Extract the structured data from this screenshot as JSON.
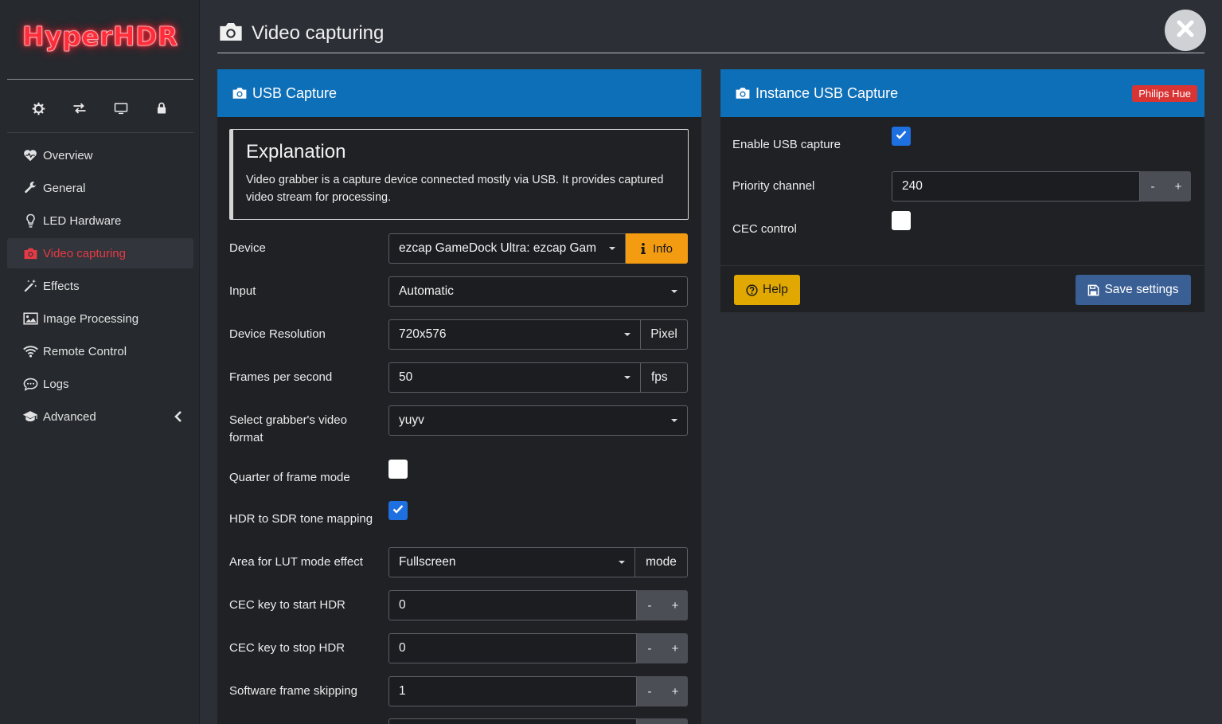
{
  "app": {
    "logo_text": "HyperHDR"
  },
  "sidebar": {
    "top_icons": [
      "gear-icon",
      "exchange-icon",
      "monitor-icon",
      "lock-icon"
    ],
    "items": [
      {
        "label": "Overview",
        "icon": "heartbeat-icon"
      },
      {
        "label": "General",
        "icon": "wrench-icon"
      },
      {
        "label": "LED Hardware",
        "icon": "lightbulb-icon"
      },
      {
        "label": "Video capturing",
        "icon": "camera-icon",
        "active": true
      },
      {
        "label": "Effects",
        "icon": "magic-wand-icon"
      },
      {
        "label": "Image Processing",
        "icon": "image-icon"
      },
      {
        "label": "Remote Control",
        "icon": "wifi-icon"
      },
      {
        "label": "Logs",
        "icon": "chat-icon"
      },
      {
        "label": "Advanced",
        "icon": "graduation-cap-icon"
      }
    ]
  },
  "header": {
    "title": "Video capturing"
  },
  "usb_panel": {
    "title": "USB Capture",
    "explanation": {
      "heading": "Explanation",
      "text": "Video grabber is a capture device connected mostly via USB. It provides captured video stream for processing."
    },
    "device": {
      "label": "Device",
      "value": "ezcap GameDock Ultra: ezcap Gam",
      "button": "Info"
    },
    "input": {
      "label": "Input",
      "value": "Automatic"
    },
    "resolution": {
      "label": "Device Resolution",
      "value": "720x576",
      "unit": "Pixel"
    },
    "fps": {
      "label": "Frames per second",
      "value": "50",
      "unit": "fps"
    },
    "format": {
      "label": "Select grabber's video format",
      "value": "yuyv"
    },
    "quarter": {
      "label": "Quarter of frame mode",
      "checked": false
    },
    "hdr": {
      "label": "HDR to SDR tone mapping",
      "checked": true
    },
    "lut": {
      "label": "Area for LUT mode effect",
      "value": "Fullscreen",
      "unit": "mode"
    },
    "cec_start": {
      "label": "CEC key to start HDR",
      "value": "0"
    },
    "cec_stop": {
      "label": "CEC key to stop HDR",
      "value": "0"
    },
    "skip": {
      "label": "Software frame skipping",
      "value": "1"
    },
    "minus": "-",
    "plus": "+"
  },
  "instance_panel": {
    "title": "Instance USB Capture",
    "badge": "Philips Hue",
    "enable": {
      "label": "Enable USB capture",
      "checked": true
    },
    "priority": {
      "label": "Priority channel",
      "value": "240"
    },
    "cec": {
      "label": "CEC control",
      "checked": false
    },
    "help_button": "Help",
    "save_button": "Save settings",
    "minus": "-",
    "plus": "+"
  },
  "colors": {
    "accent": "#0d6fb8",
    "active_nav": "#e63a45",
    "info": "#f39c12",
    "help": "#e0a800",
    "save": "#3a5f94",
    "badge": "#d93434"
  }
}
